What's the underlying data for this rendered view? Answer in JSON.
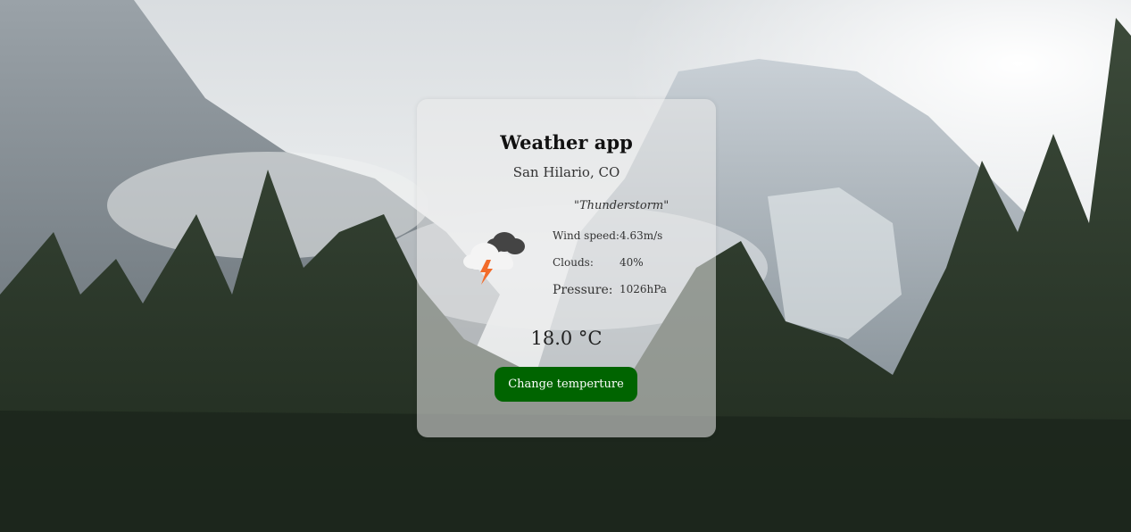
{
  "app": {
    "title": "Weather app",
    "location": "San Hilario, CO",
    "description": "\"Thunderstorm\"",
    "icon": "thunderstorm-icon",
    "stats": [
      {
        "label": "Wind speed:",
        "value": "4.63m/s"
      },
      {
        "label": "Clouds:",
        "value": "40%"
      },
      {
        "label": "Pressure:",
        "value": "1026hPa"
      }
    ],
    "temperature": "18.0 °C",
    "button_label": "Change temperture",
    "button_color": "#006400"
  }
}
